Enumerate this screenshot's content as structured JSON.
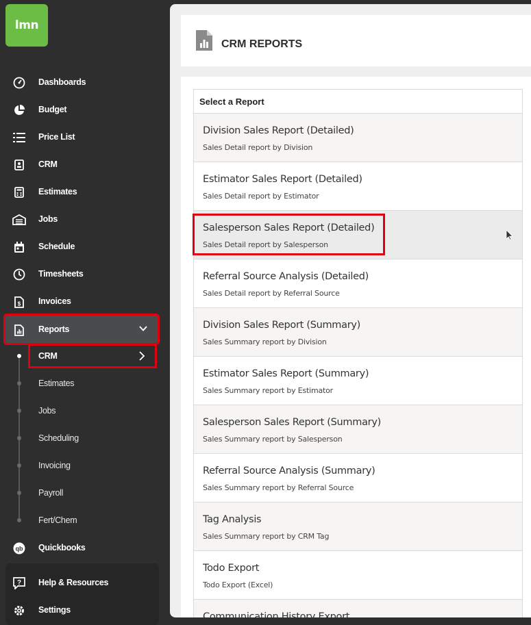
{
  "app": {
    "logo_text": "lmn"
  },
  "sidebar": {
    "items": [
      {
        "label": "Dashboards",
        "icon": "dashboard-icon"
      },
      {
        "label": "Budget",
        "icon": "pie-chart-icon"
      },
      {
        "label": "Price List",
        "icon": "list-icon"
      },
      {
        "label": "CRM",
        "icon": "contact-card-icon"
      },
      {
        "label": "Estimates",
        "icon": "calculator-icon"
      },
      {
        "label": "Jobs",
        "icon": "garage-icon"
      },
      {
        "label": "Schedule",
        "icon": "calendar-icon"
      },
      {
        "label": "Timesheets",
        "icon": "clock-icon"
      },
      {
        "label": "Invoices",
        "icon": "invoice-icon"
      },
      {
        "label": "Reports",
        "icon": "report-icon"
      }
    ],
    "reports_sub": [
      {
        "label": "CRM"
      },
      {
        "label": "Estimates"
      },
      {
        "label": "Jobs"
      },
      {
        "label": "Scheduling"
      },
      {
        "label": "Invoicing"
      },
      {
        "label": "Payroll"
      },
      {
        "label": "Fert/Chem"
      }
    ],
    "quickbooks": {
      "label": "Quickbooks",
      "icon_text": "qb"
    },
    "help": {
      "label": "Help & Resources"
    },
    "settings": {
      "label": "Settings"
    }
  },
  "main": {
    "title": "CRM REPORTS",
    "list_header": "Select a Report",
    "reports": [
      {
        "title": "Division Sales Report (Detailed)",
        "subtitle": "Sales Detail report by Division"
      },
      {
        "title": "Estimator Sales Report (Detailed)",
        "subtitle": "Sales Detail report by Estimator"
      },
      {
        "title": "Salesperson Sales Report (Detailed)",
        "subtitle": "Sales Detail report by Salesperson"
      },
      {
        "title": "Referral Source Analysis (Detailed)",
        "subtitle": "Sales Detail report by Referral Source"
      },
      {
        "title": "Division Sales Report (Summary)",
        "subtitle": "Sales Summary report by Division"
      },
      {
        "title": "Estimator Sales Report (Summary)",
        "subtitle": "Sales Summary report by Estimator"
      },
      {
        "title": "Salesperson Sales Report (Summary)",
        "subtitle": "Sales Summary report by Salesperson"
      },
      {
        "title": "Referral Source Analysis (Summary)",
        "subtitle": "Sales Summary report by Referral Source"
      },
      {
        "title": "Tag Analysis",
        "subtitle": "Sales Summary report by CRM Tag"
      },
      {
        "title": "Todo Export",
        "subtitle": "Todo Export (Excel)"
      },
      {
        "title": "Communication History Export",
        "subtitle": ""
      }
    ]
  },
  "colors": {
    "brand": "#6cbd45",
    "highlight": "#e0000f",
    "sidebar_bg": "#2e2e2e"
  }
}
